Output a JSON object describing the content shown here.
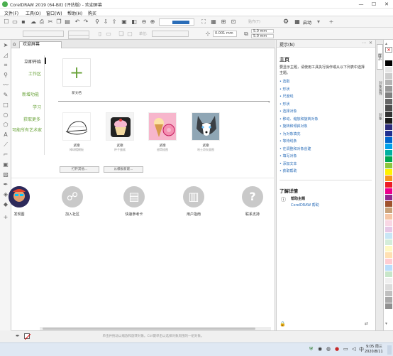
{
  "titlebar": {
    "title": "CorelDRAW 2019 (64-Bit) (评估版) - 欢迎屏幕",
    "minimize": "—",
    "maximize": "☐",
    "close": "✕"
  },
  "menubar": {
    "items": [
      "文件(F)",
      "工具(O)",
      "窗口(W)",
      "帮助(H)",
      "购买"
    ]
  },
  "toolbar": {
    "launch_label": "启动",
    "snap_label": "贴齐(T)",
    "nudge_value": "0.001 mm",
    "dup_x": "5.0 mm",
    "dup_y": "5.0 mm",
    "units_label": "单位:",
    "zoom_value": "100%"
  },
  "doc_tab": {
    "label": "欢迎屏幕",
    "home_icon": "home-icon"
  },
  "welcome": {
    "nav": [
      "立即开始",
      "工作区",
      "新增功能",
      "学习",
      "获取更多",
      "可能所有艺术家"
    ],
    "new_doc_label": "新文档",
    "templates": [
      {
        "label": "武德",
        "sub": "棒球帽模板"
      },
      {
        "label": "武德",
        "sub": "杯子蛋糕"
      },
      {
        "label": "武德",
        "sub": "甜筒插图"
      },
      {
        "label": "武德",
        "sub": "哈士奇矢量图"
      }
    ],
    "open_other_label": "打开其他...",
    "from_template_label": "从模板新建...",
    "resources": [
      "发现图",
      "加入社区",
      "快速参考卡",
      "用户指南",
      "联系支持"
    ]
  },
  "hints": {
    "panel_title": "提示(N)",
    "heading": "主页",
    "intro": "要显示主题，请使用工具执行操作或从以下列表中选择主题。",
    "links": [
      "选取",
      "形状",
      "尺度线",
      "形状",
      "选择对象",
      "移动、缩放和旋转对象",
      "旋转和倾斜对象",
      "为对象填充",
      "等待线条",
      "在调整和对象创建",
      "填写对象",
      "添加文本",
      "获取帮助"
    ],
    "learn_more_title": "了解详情",
    "help_topic_title": "帮助主题",
    "help_topic_link": "CorelDRAW 帮助"
  },
  "side_tabs": [
    "提示",
    "对象属性",
    "对象"
  ],
  "palette_colors": [
    "#ffffff",
    "#000000",
    "#e6e6e6",
    "#cccccc",
    "#b3b3b3",
    "#999999",
    "#808080",
    "#666666",
    "#4d4d4d",
    "#333333",
    "#1a1a1a",
    "#2b2b7a",
    "#1f2f8f",
    "#0066cc",
    "#00a0e9",
    "#00b0a0",
    "#00a651",
    "#8dc63f",
    "#fff200",
    "#f7941d",
    "#ed1c24",
    "#ec008c",
    "#92278f",
    "#a0522d",
    "#c8a27a",
    "#f5c6a5",
    "#f9d7e4",
    "#e6c8e6",
    "#c8e6f5",
    "#d4edda",
    "#fff9c4",
    "#ffe0b2",
    "#ffcdd2",
    "#bbdefb",
    "#c8e6c9",
    "#f0f0f0",
    "#dcdcdc",
    "#c0c0c0",
    "#a9a9a9",
    "#909090"
  ],
  "statusbar": {
    "hint": "单击并拖动以缩放和旋转对象。Ctrl键单击以选择对象周围的一组对象。"
  },
  "taskbar": {
    "time": "9:05 周三",
    "date": "2020/8/11",
    "ime": "中"
  }
}
